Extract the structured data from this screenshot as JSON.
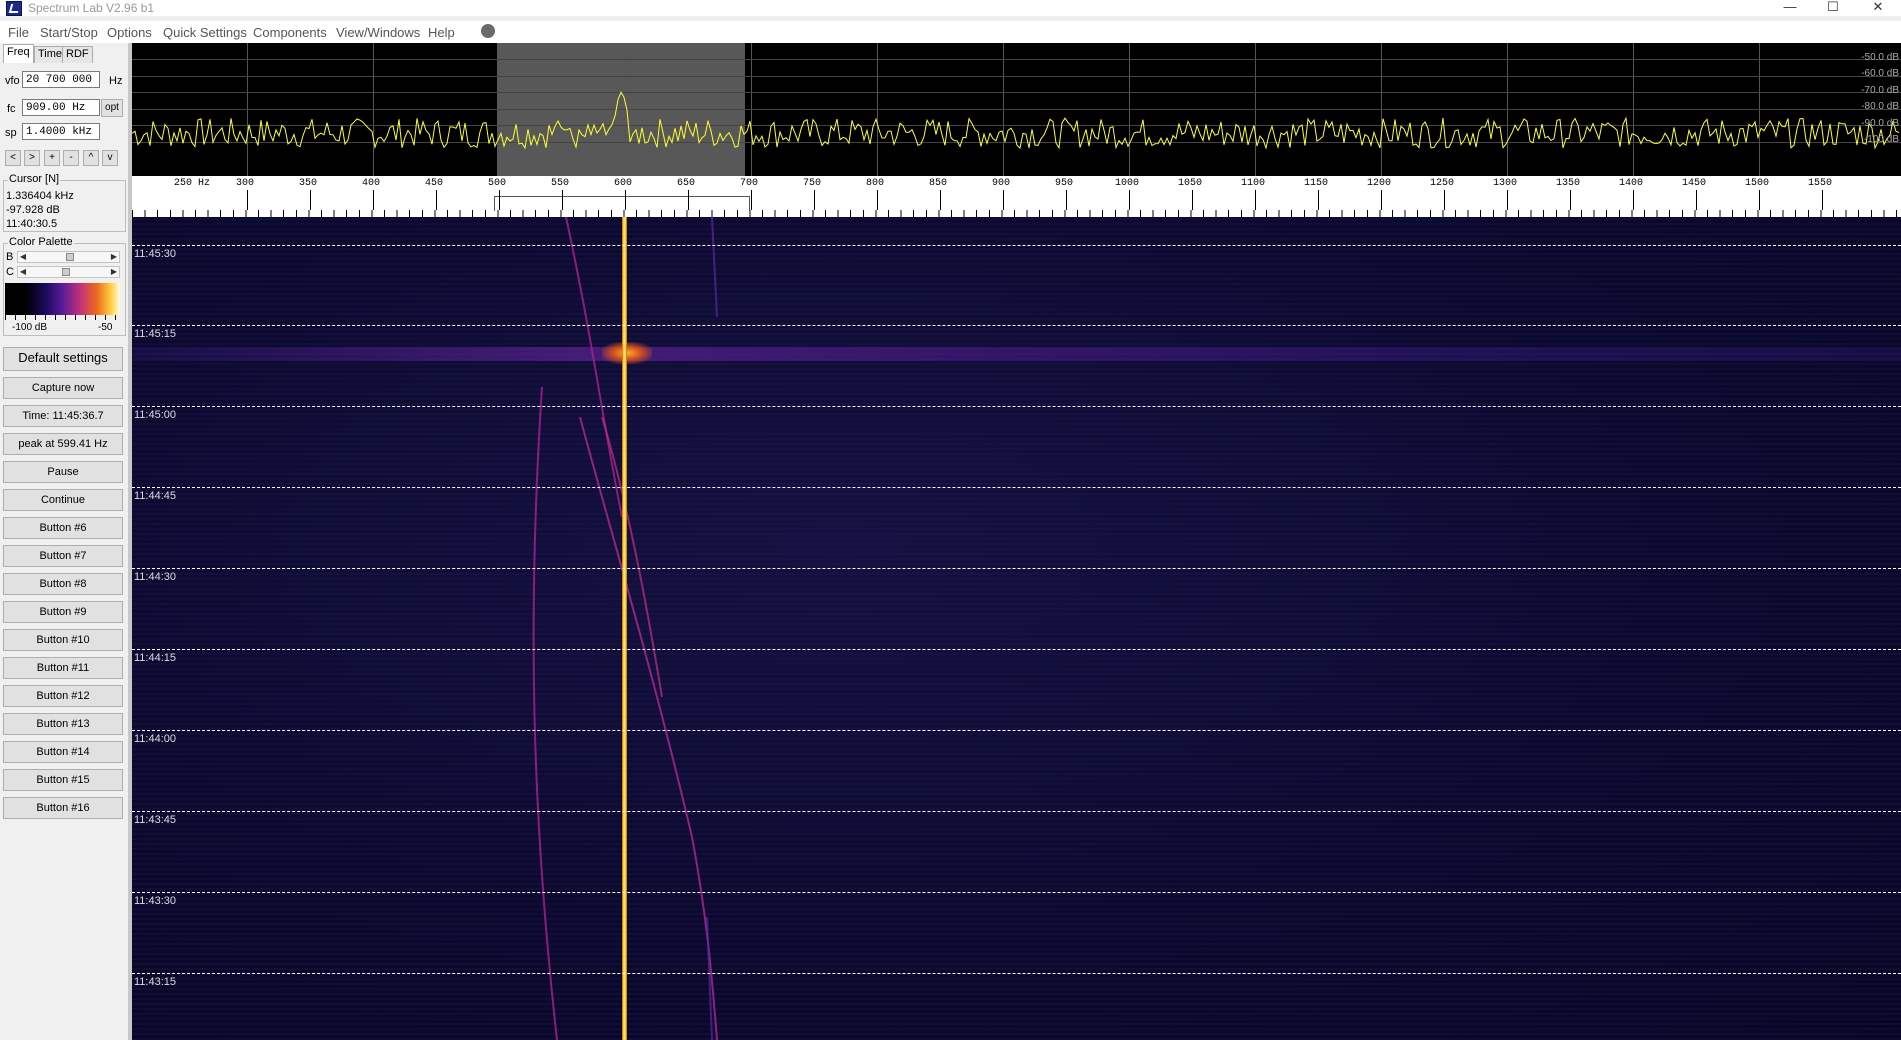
{
  "window": {
    "title": "Spectrum Lab V2.96 b1"
  },
  "menu": [
    "File",
    "Start/Stop",
    "Options",
    "Quick Settings",
    "Components",
    "View/Windows",
    "Help"
  ],
  "tabs": [
    "Freq",
    "Time",
    "RDF"
  ],
  "controls": {
    "vfo_label": "vfo",
    "vfo_value": "20 700 000",
    "vfo_unit": "Hz",
    "fc_label": "fc",
    "fc_value": "909.00 Hz",
    "opt_label": "opt",
    "sp_label": "sp",
    "sp_value": "1.4000 kHz",
    "nav": [
      "<",
      ">",
      "+",
      "-",
      "^",
      "v"
    ]
  },
  "cursor": {
    "title": "Cursor [N]",
    "freq": "1.336404 kHz",
    "level": "-97.928 dB",
    "time": "11:40:30.5"
  },
  "palette": {
    "title": "Color Palette",
    "b_label": "B",
    "c_label": "C",
    "min_label": "-100 dB",
    "max_label": "-50"
  },
  "buttons": [
    "Default settings",
    "Capture now",
    "Time:  11:45:36.7",
    "peak at 599.41 Hz",
    "Pause",
    "Continue",
    "Button #6",
    "Button #7",
    "Button #8",
    "Button #9",
    "Button #10",
    "Button #11",
    "Button #12",
    "Button #13",
    "Button #14",
    "Button #15",
    "Button #16"
  ],
  "spectrum": {
    "db_labels": [
      "-50.0 dB",
      "-60.0 dB",
      "-70.0 dB",
      "-80.0 dB",
      "-90.0 dB",
      "-100 dB"
    ]
  },
  "freq_axis": [
    "250 Hz",
    "300",
    "350",
    "400",
    "450",
    "500",
    "550",
    "600",
    "650",
    "700",
    "750",
    "800",
    "850",
    "900",
    "950",
    "1000",
    "1050",
    "1100",
    "1150",
    "1200",
    "1250",
    "1300",
    "1350",
    "1400",
    "1450",
    "1500",
    "1550"
  ],
  "waterfall": {
    "times": [
      "11:45:30",
      "11:45:15",
      "11:45:00",
      "11:44:45",
      "11:44:30",
      "11:44:15",
      "11:44:00",
      "11:43:45",
      "11:43:30",
      "11:43:15"
    ]
  },
  "colors": {
    "trace": "#ffff33",
    "carrier": "#ffcc33"
  }
}
